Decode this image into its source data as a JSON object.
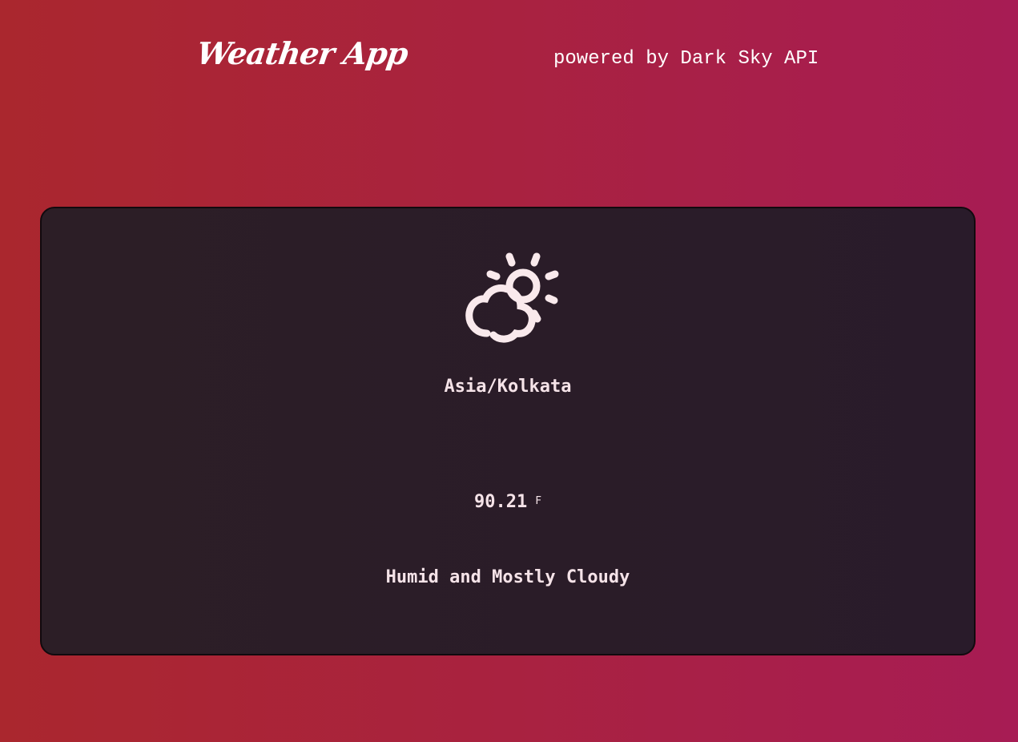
{
  "header": {
    "brand": "Weather App",
    "powered_by": "powered by Dark Sky API"
  },
  "weather": {
    "icon": "partly-cloudy-day-icon",
    "timezone": "Asia/Kolkata",
    "temperature": "90.21",
    "unit": "F",
    "summary": "Humid and Mostly Cloudy"
  },
  "colors": {
    "background_start": "#aa272e",
    "background_end": "#a71c54",
    "card": "#2a1d28",
    "icon": "#f9e9ec",
    "text": "#f5e3e8"
  }
}
